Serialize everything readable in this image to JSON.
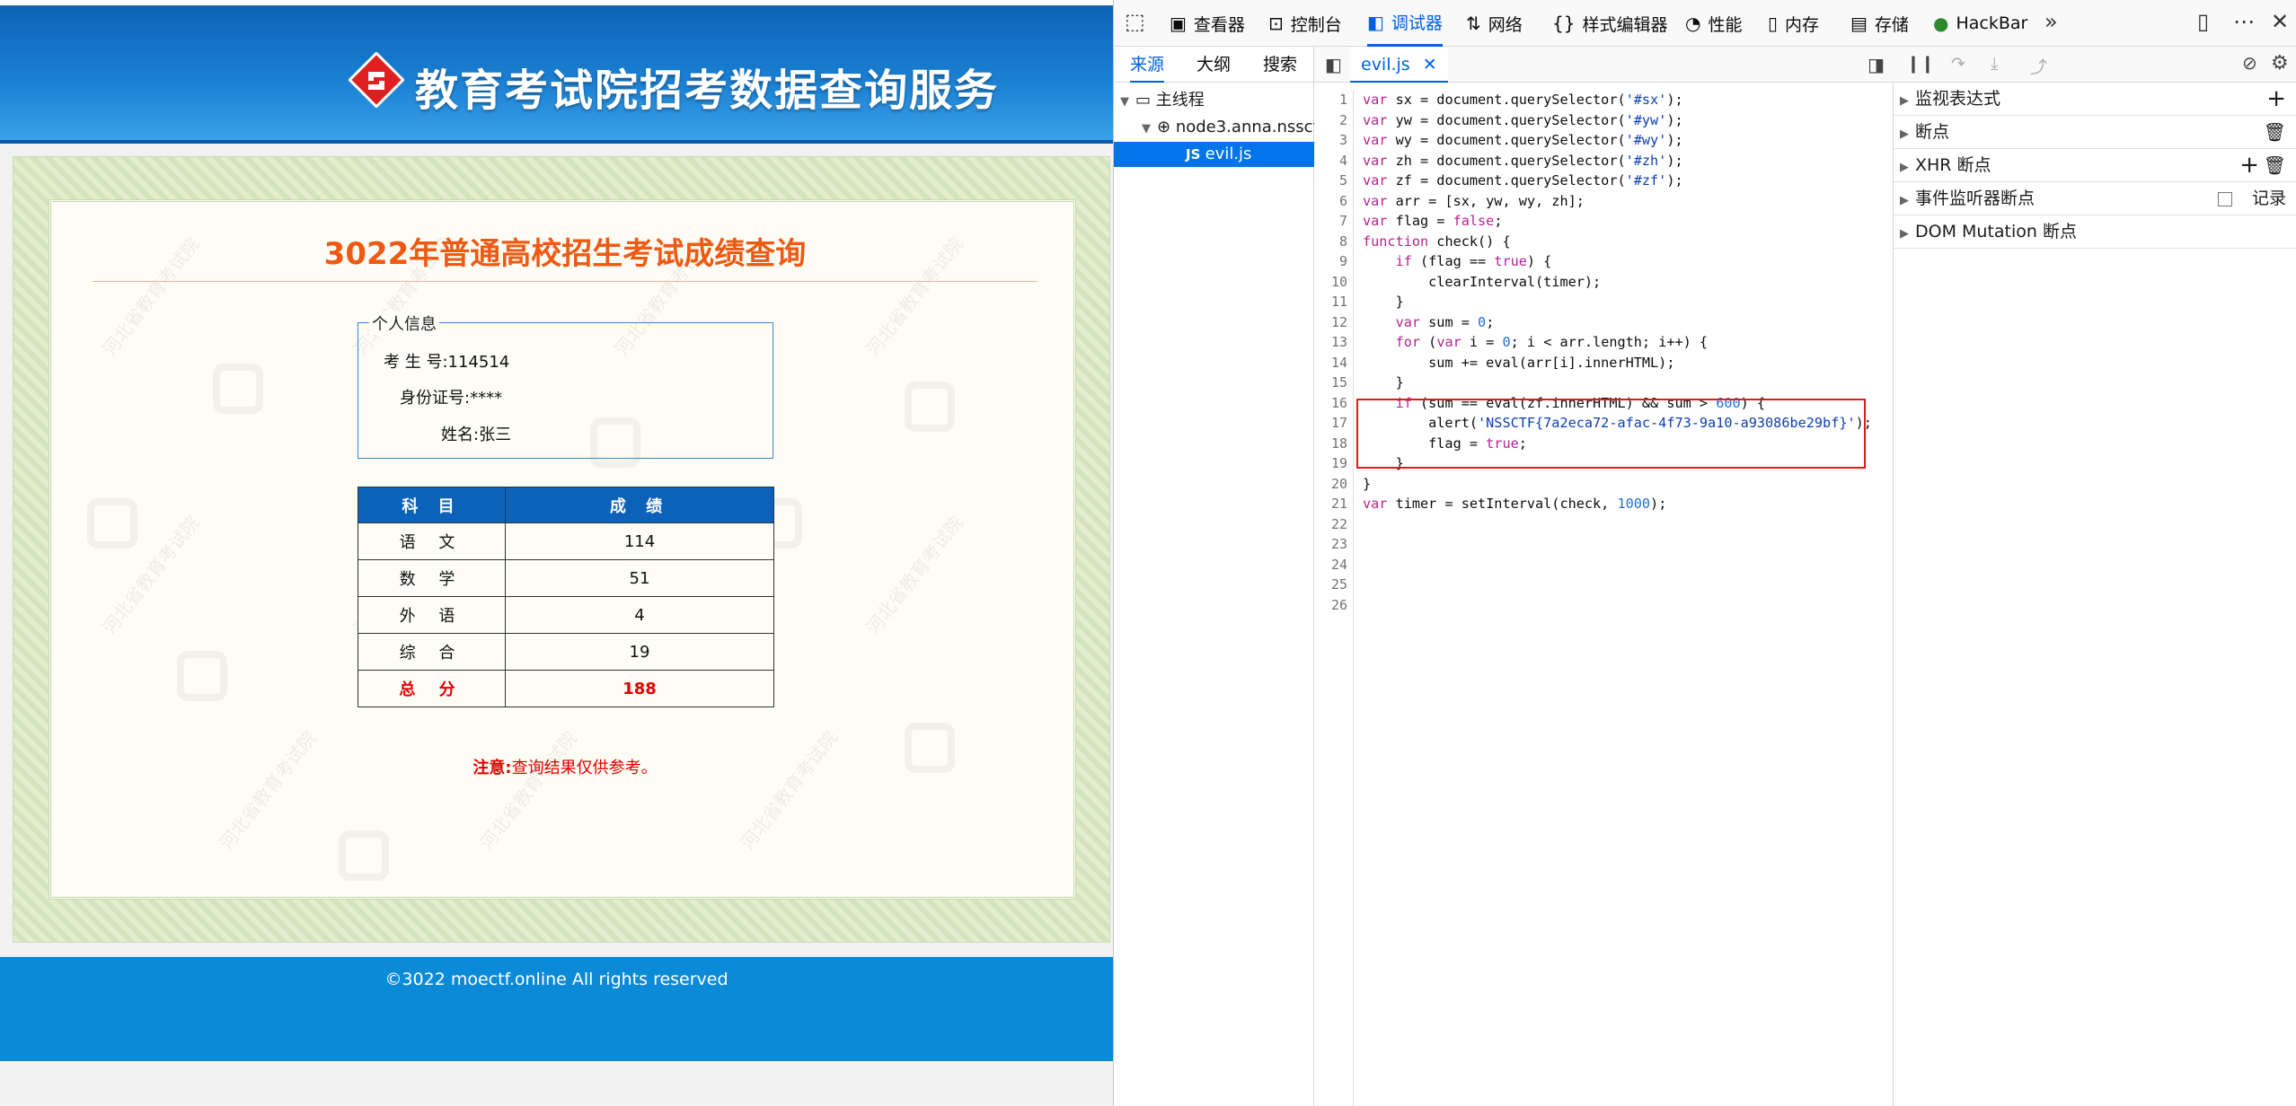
{
  "page": {
    "site_title": "教育考试院招考数据查询服务",
    "score_title": "3022年普通高校招生考试成绩查询",
    "watermark_text": "河北省教育考试院",
    "info": {
      "legend": "个人信息",
      "candidate_no_label": "考 生 号:",
      "candidate_no": "114514",
      "id_label": "身份证号:",
      "id_value": "****",
      "name_label": "姓名:",
      "name_value": "张三"
    },
    "table": {
      "headers": [
        "科 目",
        "成 绩"
      ],
      "rows": [
        {
          "subject": "语 文",
          "score": "114"
        },
        {
          "subject": "数 学",
          "score": "51"
        },
        {
          "subject": "外 语",
          "score": "4"
        },
        {
          "subject": "综 合",
          "score": "19"
        }
      ],
      "total_label": "总 分",
      "total_value": "188"
    },
    "note_label": "注意:",
    "note_text": "查询结果仅供参考。",
    "footer": "©3022 moectf.online All rights reserved"
  },
  "devtools": {
    "tabs": [
      {
        "label": "查看器",
        "icon": "inspector-icon"
      },
      {
        "label": "控制台",
        "icon": "console-icon"
      },
      {
        "label": "调试器",
        "icon": "debugger-icon",
        "active": true
      },
      {
        "label": "网络",
        "icon": "network-icon"
      },
      {
        "label": "样式编辑器",
        "icon": "style-editor-icon"
      },
      {
        "label": "性能",
        "icon": "performance-icon"
      },
      {
        "label": "内存",
        "icon": "memory-icon"
      },
      {
        "label": "存储",
        "icon": "storage-icon"
      },
      {
        "label": "HackBar",
        "icon": "hackbar-icon"
      }
    ],
    "sources": {
      "tabs": [
        "来源",
        "大纲",
        "搜索"
      ],
      "tree": {
        "main_thread": "主线程",
        "host": "node3.anna.nssctf",
        "file": "evil.js"
      }
    },
    "editor": {
      "file_tab": "evil.js",
      "line_numbers": [
        "1",
        "2",
        "3",
        "4",
        "5",
        "6",
        "7",
        "8",
        "9",
        "10",
        "11",
        "12",
        "13",
        "14",
        "15",
        "16",
        "17",
        "18",
        "19",
        "20",
        "21",
        "22",
        "23",
        "24",
        "25",
        "26"
      ],
      "lines": [
        "var sx = document.querySelector('#sx');",
        "var yw = document.querySelector('#yw');",
        "var wy = document.querySelector('#wy');",
        "var zh = document.querySelector('#zh');",
        "var zf = document.querySelector('#zf');",
        "var arr = [sx, yw, wy, zh];",
        "var flag = false;",
        "function check() {",
        "    if (flag == true) {",
        "        clearInterval(timer);",
        "    }",
        "    var sum = 0;",
        "    for (var i = 0; i < arr.length; i++) {",
        "        sum += eval(arr[i].innerHTML);",
        "    }",
        "    if (sum == eval(zf.innerHTML) && sum > 600) {",
        "        alert('NSSCTF{7a2eca72-afac-4f73-9a10-a93086be29bf}');",
        "        flag = true;",
        "    }",
        "}",
        "var timer = setInterval(check, 1000);",
        "",
        "",
        "",
        "",
        ""
      ]
    },
    "side_panel": {
      "items": [
        "监视表达式",
        "断点",
        "XHR 断点",
        "事件监听器断点",
        "DOM Mutation 断点"
      ],
      "record_label": "记录"
    }
  }
}
